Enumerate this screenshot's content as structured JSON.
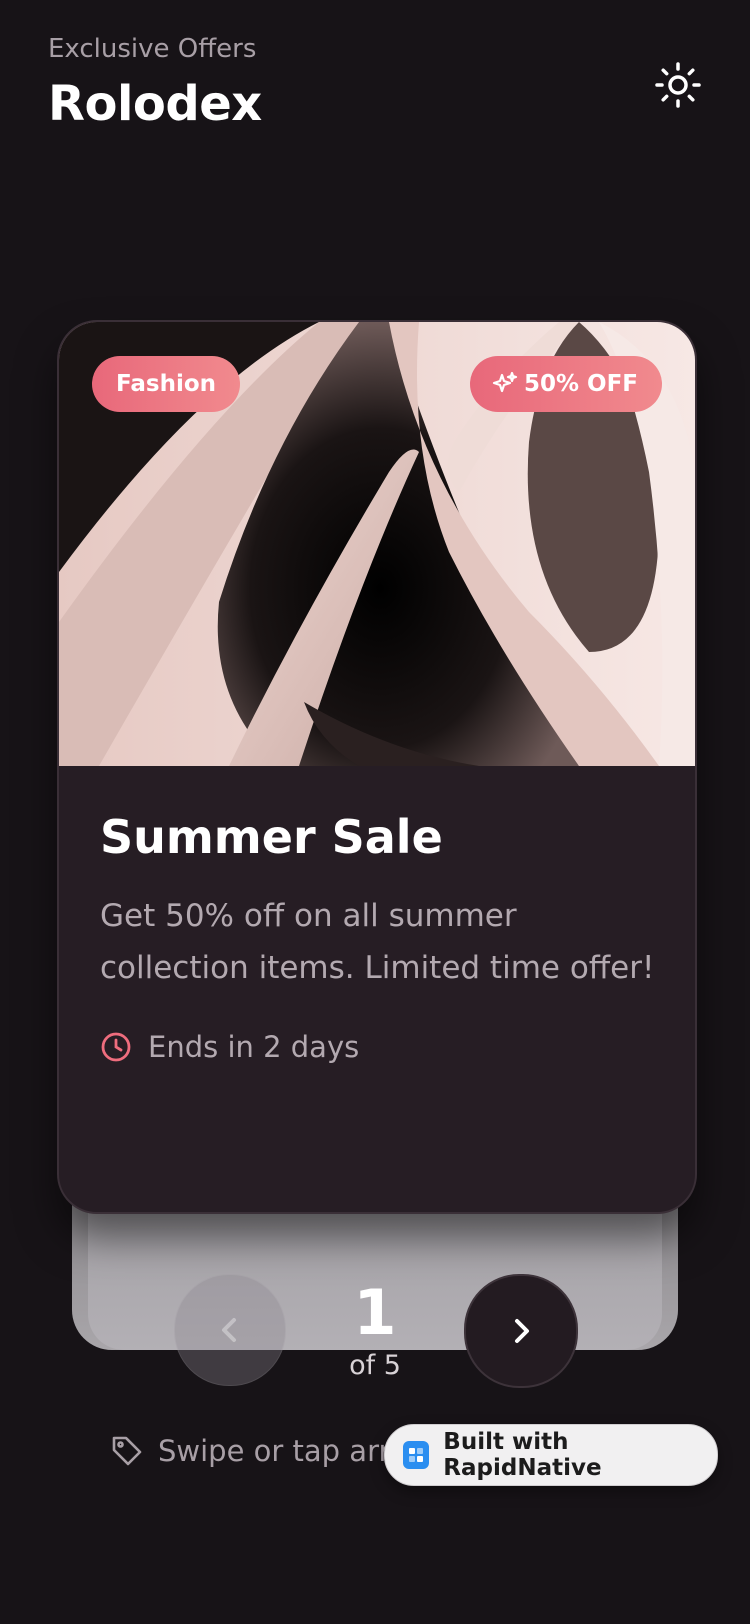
{
  "header": {
    "subtitle": "Exclusive Offers",
    "title": "Rolodex",
    "theme_icon": "sun-icon"
  },
  "card": {
    "category": "Fashion",
    "discount": "50% OFF",
    "discount_icon": "sparkles-icon",
    "title": "Summer Sale",
    "description": "Get 50% off on all summer collection items. Limited time offer!",
    "ends": "Ends in 2 days",
    "ends_icon": "clock-icon"
  },
  "pager": {
    "current": "1",
    "total": "of 5",
    "prev_icon": "chevron-left-icon",
    "next_icon": "chevron-right-icon"
  },
  "hint": {
    "text": "Swipe or tap arro",
    "icon": "tag-icon"
  },
  "built": {
    "label": "Built with RapidNative"
  },
  "colors": {
    "background": "#171317",
    "card": "#261d24",
    "accent": "#e8687a"
  }
}
